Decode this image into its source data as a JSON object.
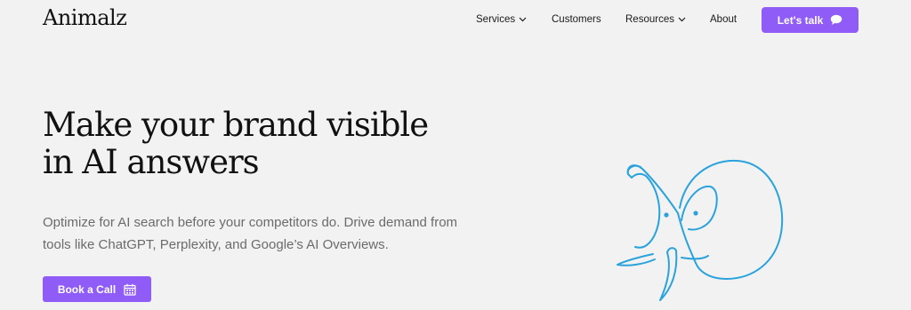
{
  "brand": {
    "logo": "Animalz"
  },
  "nav": {
    "services": "Services",
    "customers": "Customers",
    "resources": "Resources",
    "about": "About",
    "cta": "Let's talk",
    "cta_icon": "chat-bubble-icon",
    "dropdown_icon": "chevron-down-icon"
  },
  "hero": {
    "title_line1": "Make your brand visible",
    "title_line2": "in AI answers",
    "subtitle_line1": "Optimize for AI search before your competitors do. Drive demand from",
    "subtitle_line2": "tools like ChatGPT, Perplexity, and Google’s AI Overviews.",
    "button": "Book a Call",
    "button_icon": "calendar-icon",
    "illustration": "elephant-line-drawing"
  },
  "colors": {
    "accent": "#8f5cf7",
    "background": "#f2f2f2",
    "illustration": "#2aa3dc"
  }
}
